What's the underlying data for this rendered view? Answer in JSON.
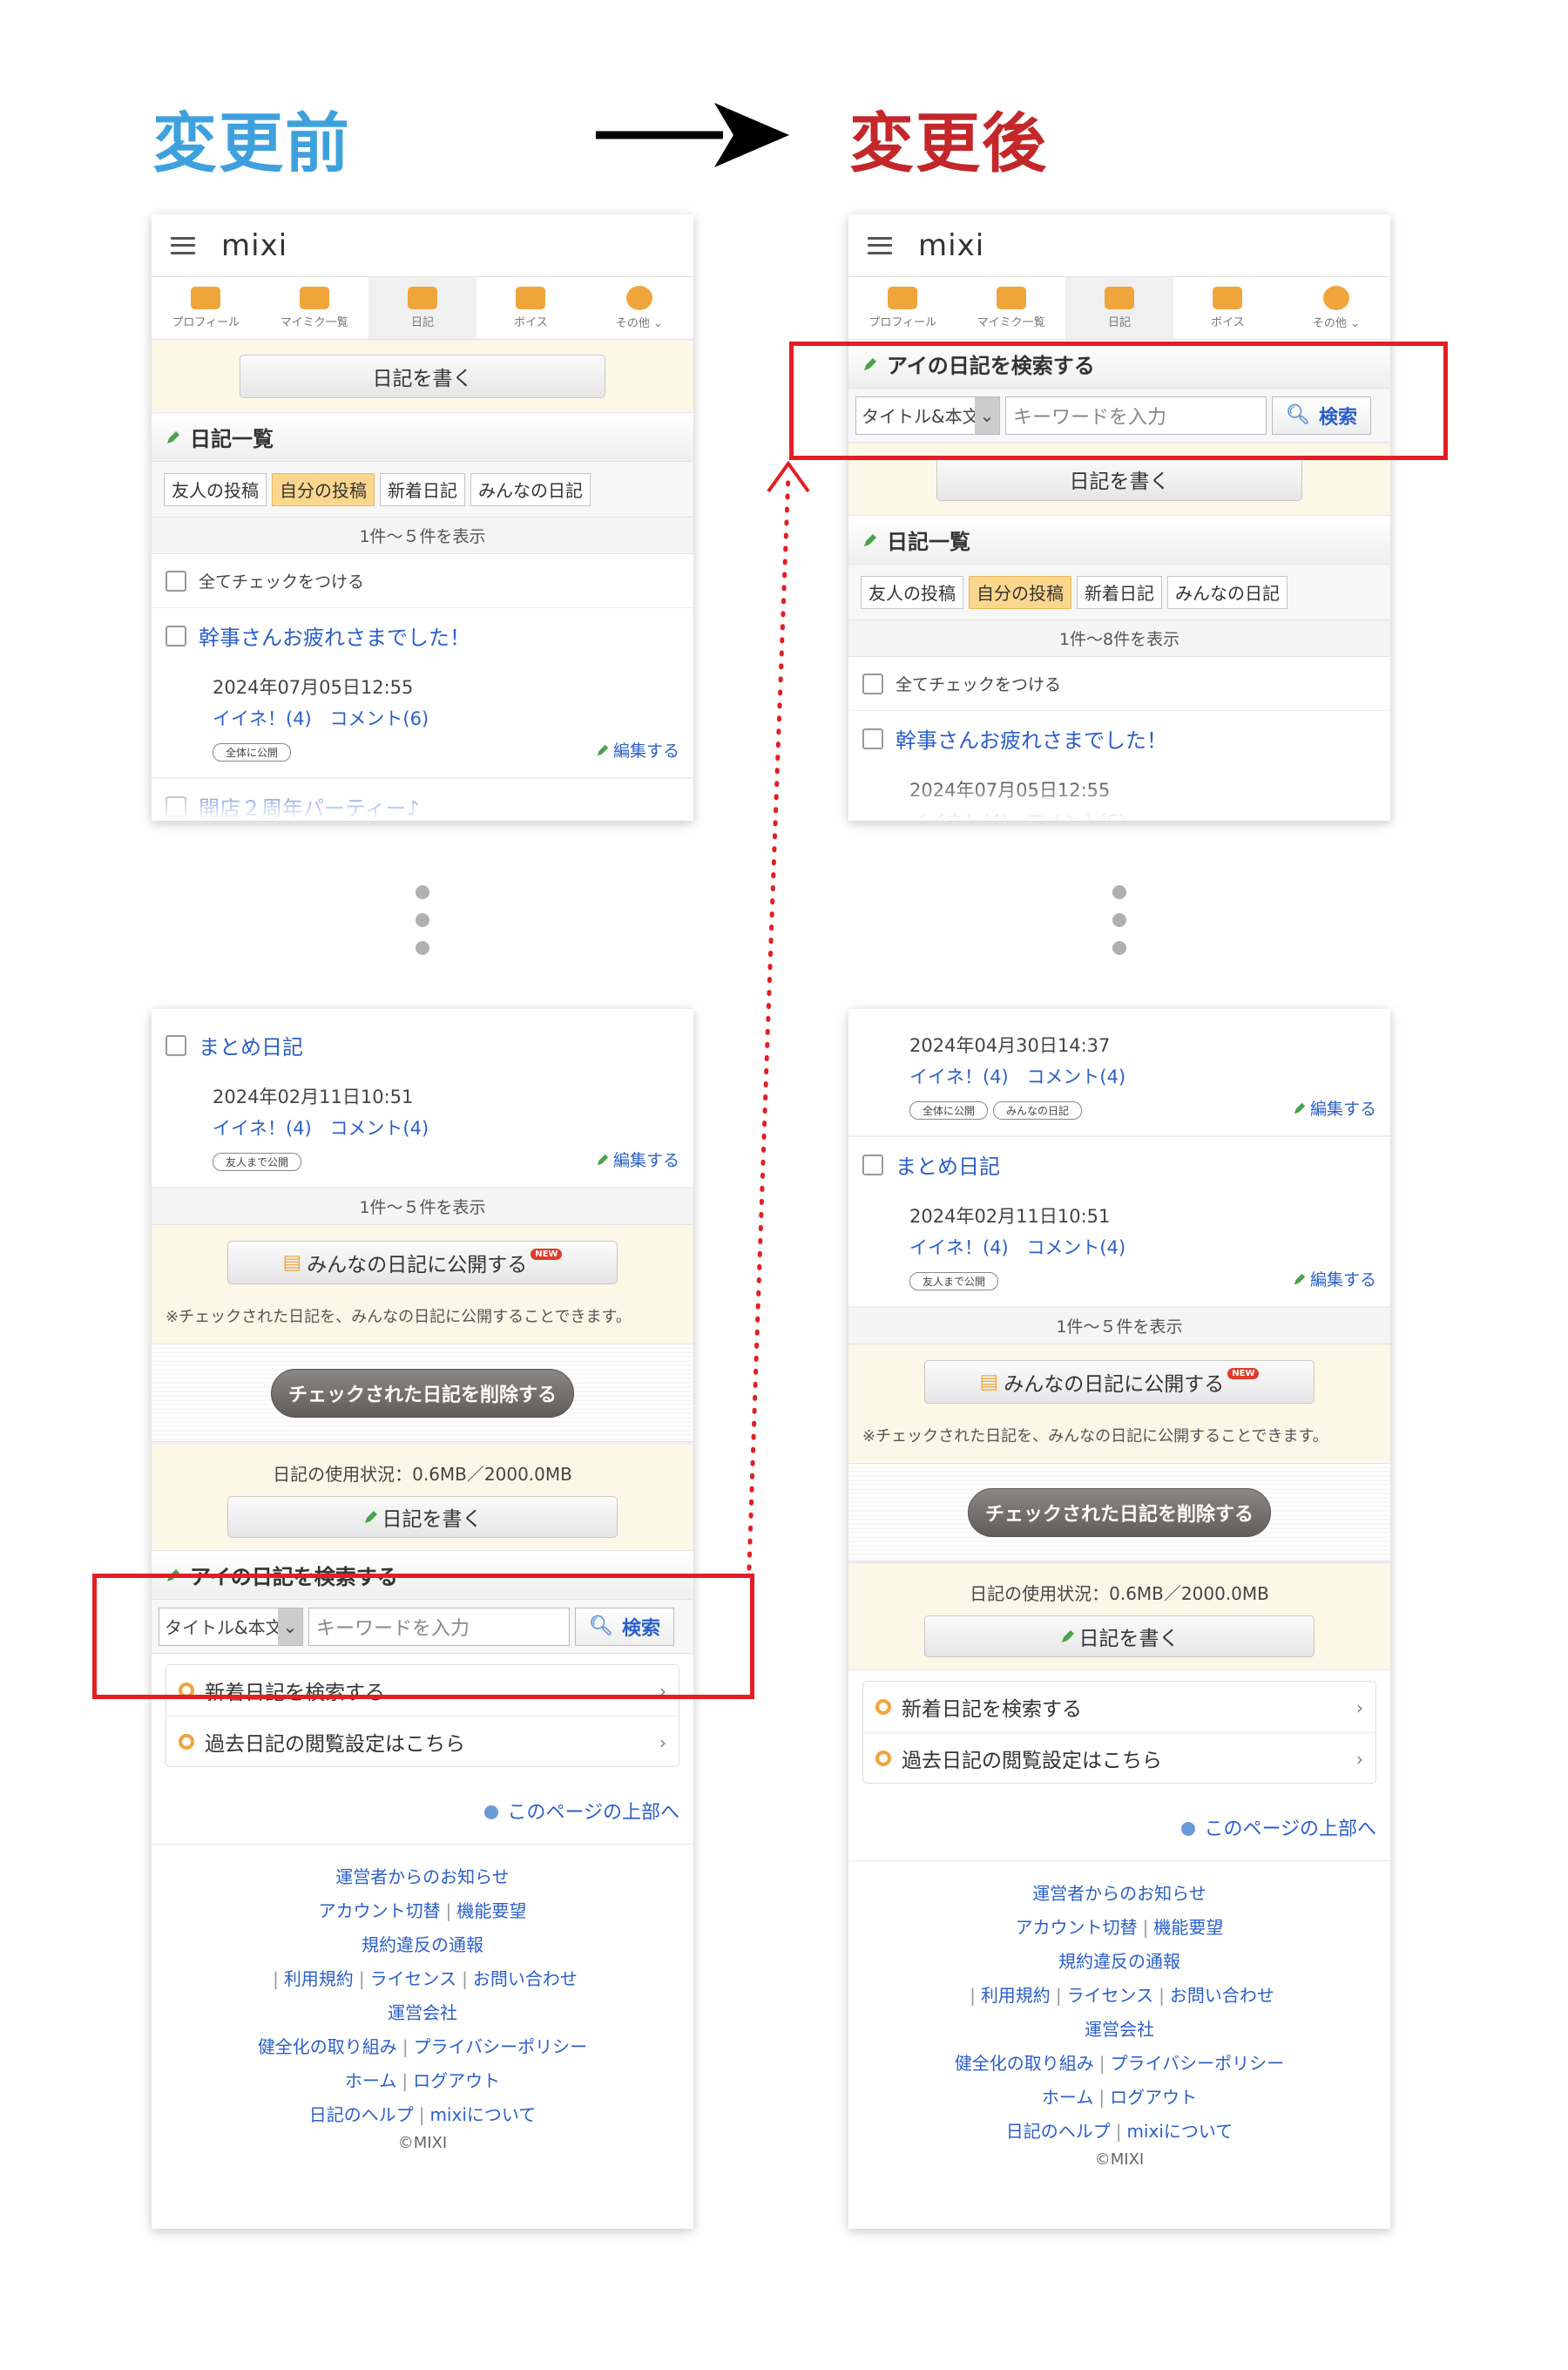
{
  "headings": {
    "before": "変更前",
    "after": "変更後"
  },
  "app": {
    "logo": "mixi"
  },
  "nav": [
    {
      "label": "プロフィール",
      "icon": "profile-icon"
    },
    {
      "label": "マイミク一覧",
      "icon": "friends-icon"
    },
    {
      "label": "日記",
      "icon": "diary-icon"
    },
    {
      "label": "ボイス",
      "icon": "voice-icon"
    },
    {
      "label": "その他 ⌄",
      "icon": "more-icon"
    }
  ],
  "write_button": "日記を書く",
  "diary_list": {
    "heading": "日記一覧",
    "tabs": [
      "友人の投稿",
      "自分の投稿",
      "新着日記",
      "みんなの日記"
    ],
    "selected_tab": 1
  },
  "count_before_top": "1件〜５件を表示",
  "count_after_top": "1件〜8件を表示",
  "count_bottom": "1件〜５件を表示",
  "check_all": "全てチェックをつける",
  "entries": {
    "e1": {
      "title": "幹事さんお疲れさまでした！",
      "date": "2024年07月05日12:55",
      "likes": "イイネ！(4)",
      "comments": "コメント(6)",
      "badges": [
        "全体に公開"
      ]
    },
    "e2": {
      "title": "開店２周年パーティー♪"
    },
    "e_prev": {
      "date": "2024年04月30日14:37",
      "likes": "イイネ！(4)",
      "comments": "コメント(4)",
      "badges": [
        "全体に公開",
        "みんなの日記"
      ]
    },
    "e_last": {
      "title": "まとめ日記",
      "date": "2024年02月11日10:51",
      "likes": "イイネ！(4)",
      "comments": "コメント(4)",
      "badges": [
        "友人まで公開"
      ]
    }
  },
  "edit_label": "編集する",
  "search": {
    "heading": "アイの日記を検索する",
    "select_value": "タイトル&本文",
    "placeholder": "キーワードを入力",
    "button": "検索"
  },
  "publish": {
    "button": "みんなの日記に公開する",
    "new_tag": "NEW",
    "note": "※チェックされた日記を、みんなの日記に公開することできます。"
  },
  "delete_button": "チェックされた日記を削除する",
  "usage": "日記の使用状況：0.6MB／2000.0MB",
  "links": [
    "新着日記を検索する",
    "過去日記の閲覧設定はこちら"
  ],
  "to_top": "このページの上部へ",
  "footer": {
    "l1": "運営者からのお知らせ",
    "l2a": "アカウント切替",
    "l2b": "機能要望",
    "l3": "規約違反の通報",
    "l4a": "利用規約",
    "l4b": "ライセンス",
    "l4c": "お問い合わせ",
    "l5": "運営会社",
    "l6a": "健全化の取り組み",
    "l6b": "プライバシーポリシー",
    "l7a": "ホーム",
    "l7b": "ログアウト",
    "l8a": "日記のヘルプ",
    "l8b": "mixiについて",
    "copyright": "©MIXI"
  },
  "colors": {
    "before": "#3ea1de",
    "after": "#c4272a",
    "highlight": "#e31e24",
    "link": "#2b5fc9",
    "accent": "#f0a53b"
  }
}
